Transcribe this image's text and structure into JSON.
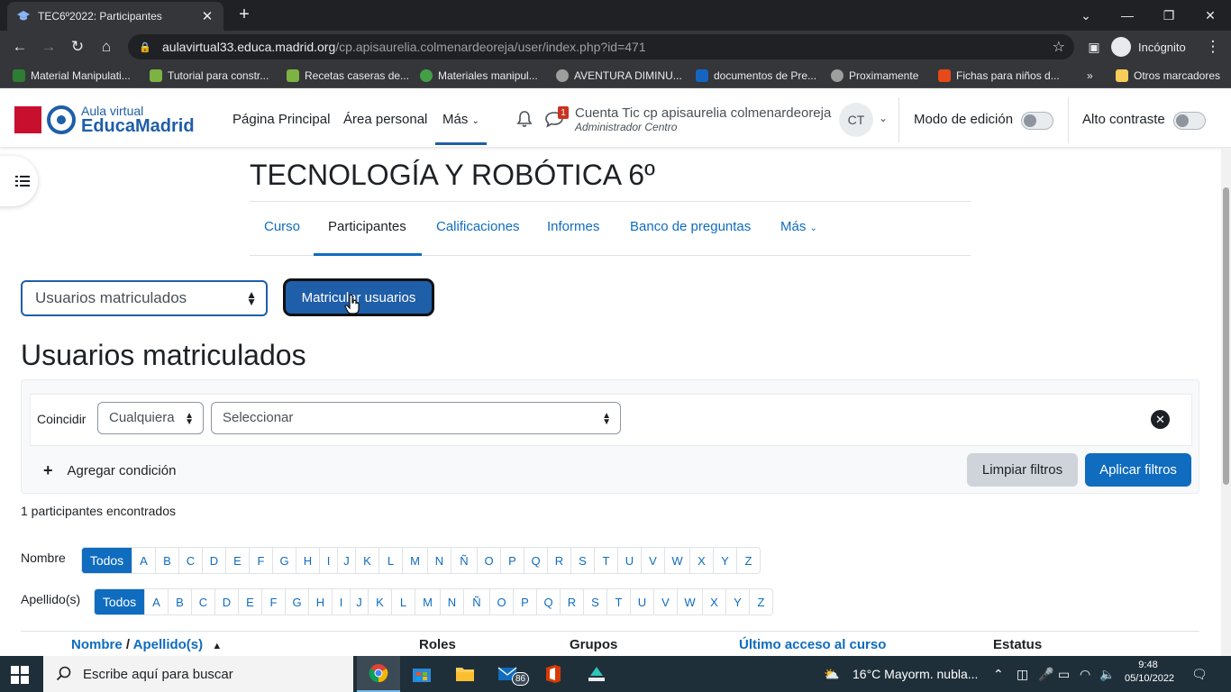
{
  "browser": {
    "tab_title": "TEC6º2022: Participantes",
    "url_host": "aulavirtual33.educa.madrid.org",
    "url_path": "/cp.apisaurelia.colmenardeoreja/user/index.php?id=471",
    "profile_label": "Incógnito",
    "bookmarks": [
      {
        "label": "Material Manipulati...",
        "color": "#2e7d32"
      },
      {
        "label": "Tutorial para constr...",
        "color": "#7cb342"
      },
      {
        "label": "Recetas caseras de...",
        "color": "#7cb342"
      },
      {
        "label": "Materiales manipul...",
        "color": "#43a047"
      },
      {
        "label": "AVENTURA DIMINU...",
        "color": "#9e9e9e"
      },
      {
        "label": "documentos de Pre...",
        "color": "#1565c0"
      },
      {
        "label": "Proximamente",
        "color": "#9e9e9e"
      },
      {
        "label": "Fichas para niños d...",
        "color": "#e64a19"
      }
    ],
    "bookmarks_overflow": "»",
    "other_bookmarks": "Otros marcadores"
  },
  "header": {
    "logo_line1": "Aula virtual",
    "logo_line2": "EducaMadrid",
    "nav": [
      "Página Principal",
      "Área personal",
      "Más"
    ],
    "messages_badge": "1",
    "user_name": "Cuenta Tic cp apisaurelia colmenardeoreja",
    "user_role": "Administrador Centro",
    "avatar_initials": "CT",
    "edit_mode_label": "Modo de edición",
    "high_contrast_label": "Alto contraste"
  },
  "course": {
    "title": "TECNOLOGÍA Y ROBÓTICA 6º",
    "tabs": [
      "Curso",
      "Participantes",
      "Calificaciones",
      "Informes",
      "Banco de preguntas",
      "Más"
    ],
    "active_tab": "Participantes"
  },
  "participants": {
    "select_value": "Usuarios matriculados",
    "enrol_button": "Matricular usuarios",
    "heading": "Usuarios matriculados",
    "filter": {
      "match_label": "Coincidir",
      "match_value": "Cualquiera",
      "select_placeholder": "Seleccionar",
      "add_condition": "Agregar condición",
      "clear_button": "Limpiar filtros",
      "apply_button": "Aplicar filtros"
    },
    "count_text": "1 participantes encontrados",
    "firstname_label": "Nombre",
    "lastname_label": "Apellido(s)",
    "all_label": "Todos",
    "letters": [
      "A",
      "B",
      "C",
      "D",
      "E",
      "F",
      "G",
      "H",
      "I",
      "J",
      "K",
      "L",
      "M",
      "N",
      "Ñ",
      "O",
      "P",
      "Q",
      "R",
      "S",
      "T",
      "U",
      "V",
      "W",
      "X",
      "Y",
      "Z"
    ],
    "table_headers": {
      "name_first": "Nombre",
      "name_sep": " / ",
      "name_last": "Apellido(s)",
      "roles": "Roles",
      "groups": "Grupos",
      "last_access": "Último acceso al curso",
      "status": "Estatus"
    }
  },
  "taskbar": {
    "search_placeholder": "Escribe aquí para buscar",
    "mail_badge": "86",
    "weather": "16°C  Mayorm. nubla...",
    "time": "9:48",
    "date": "05/10/2022"
  },
  "colors": {
    "primary": "#0f6cbf",
    "brand_blue": "#1f5ea8",
    "brand_red": "#c8102e"
  }
}
